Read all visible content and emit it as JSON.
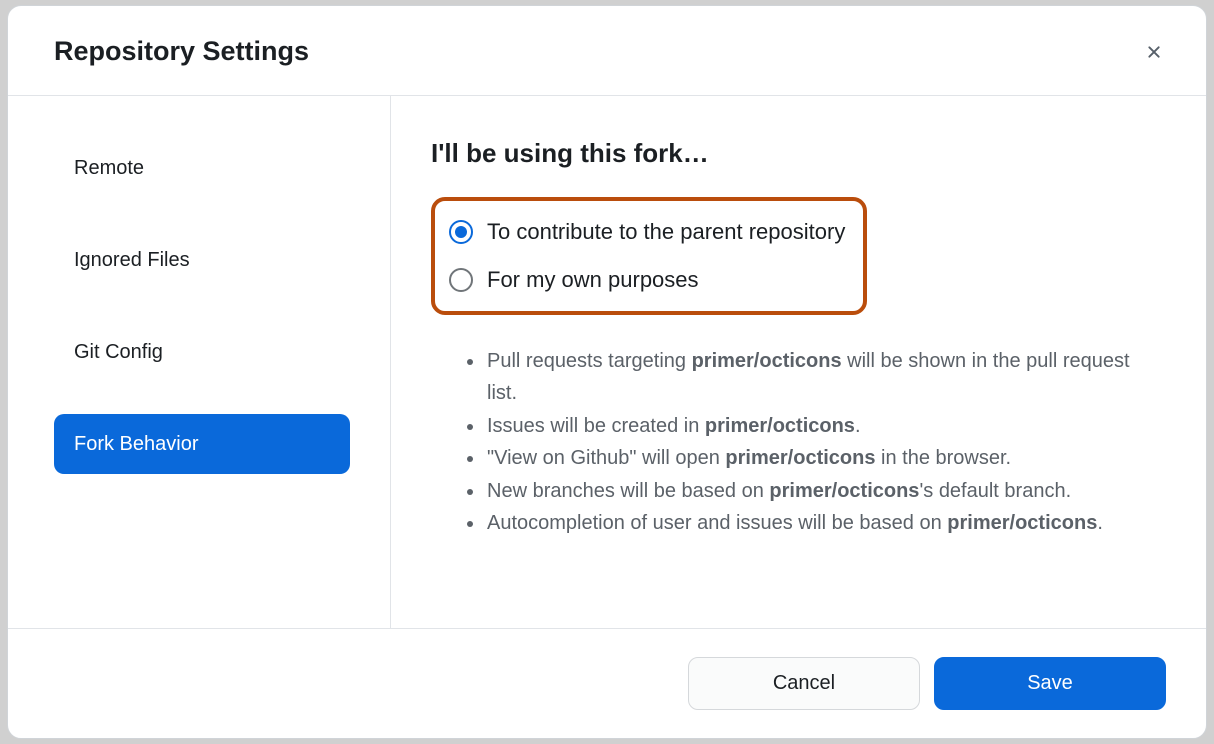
{
  "dialog": {
    "title": "Repository Settings"
  },
  "sidebar": {
    "items": [
      {
        "label": "Remote",
        "active": false
      },
      {
        "label": "Ignored Files",
        "active": false
      },
      {
        "label": "Git Config",
        "active": false
      },
      {
        "label": "Fork Behavior",
        "active": true
      }
    ]
  },
  "content": {
    "heading": "I'll be using this fork…",
    "radios": [
      {
        "label": "To contribute to the parent repository",
        "selected": true
      },
      {
        "label": "For my own purposes",
        "selected": false
      }
    ],
    "repo": "primer/octicons",
    "bullets": [
      {
        "pre": "Pull requests targeting ",
        "bold": "primer/octicons",
        "post": " will be shown in the pull request list."
      },
      {
        "pre": "Issues will be created in ",
        "bold": "primer/octicons",
        "post": "."
      },
      {
        "pre": "\"View on Github\" will open ",
        "bold": "primer/octicons",
        "post": " in the browser."
      },
      {
        "pre": "New branches will be based on ",
        "bold": "primer/octicons",
        "post": "'s default branch."
      },
      {
        "pre": "Autocompletion of user and issues will be based on ",
        "bold": "primer/octicons",
        "post": "."
      }
    ]
  },
  "footer": {
    "cancel": "Cancel",
    "save": "Save"
  }
}
